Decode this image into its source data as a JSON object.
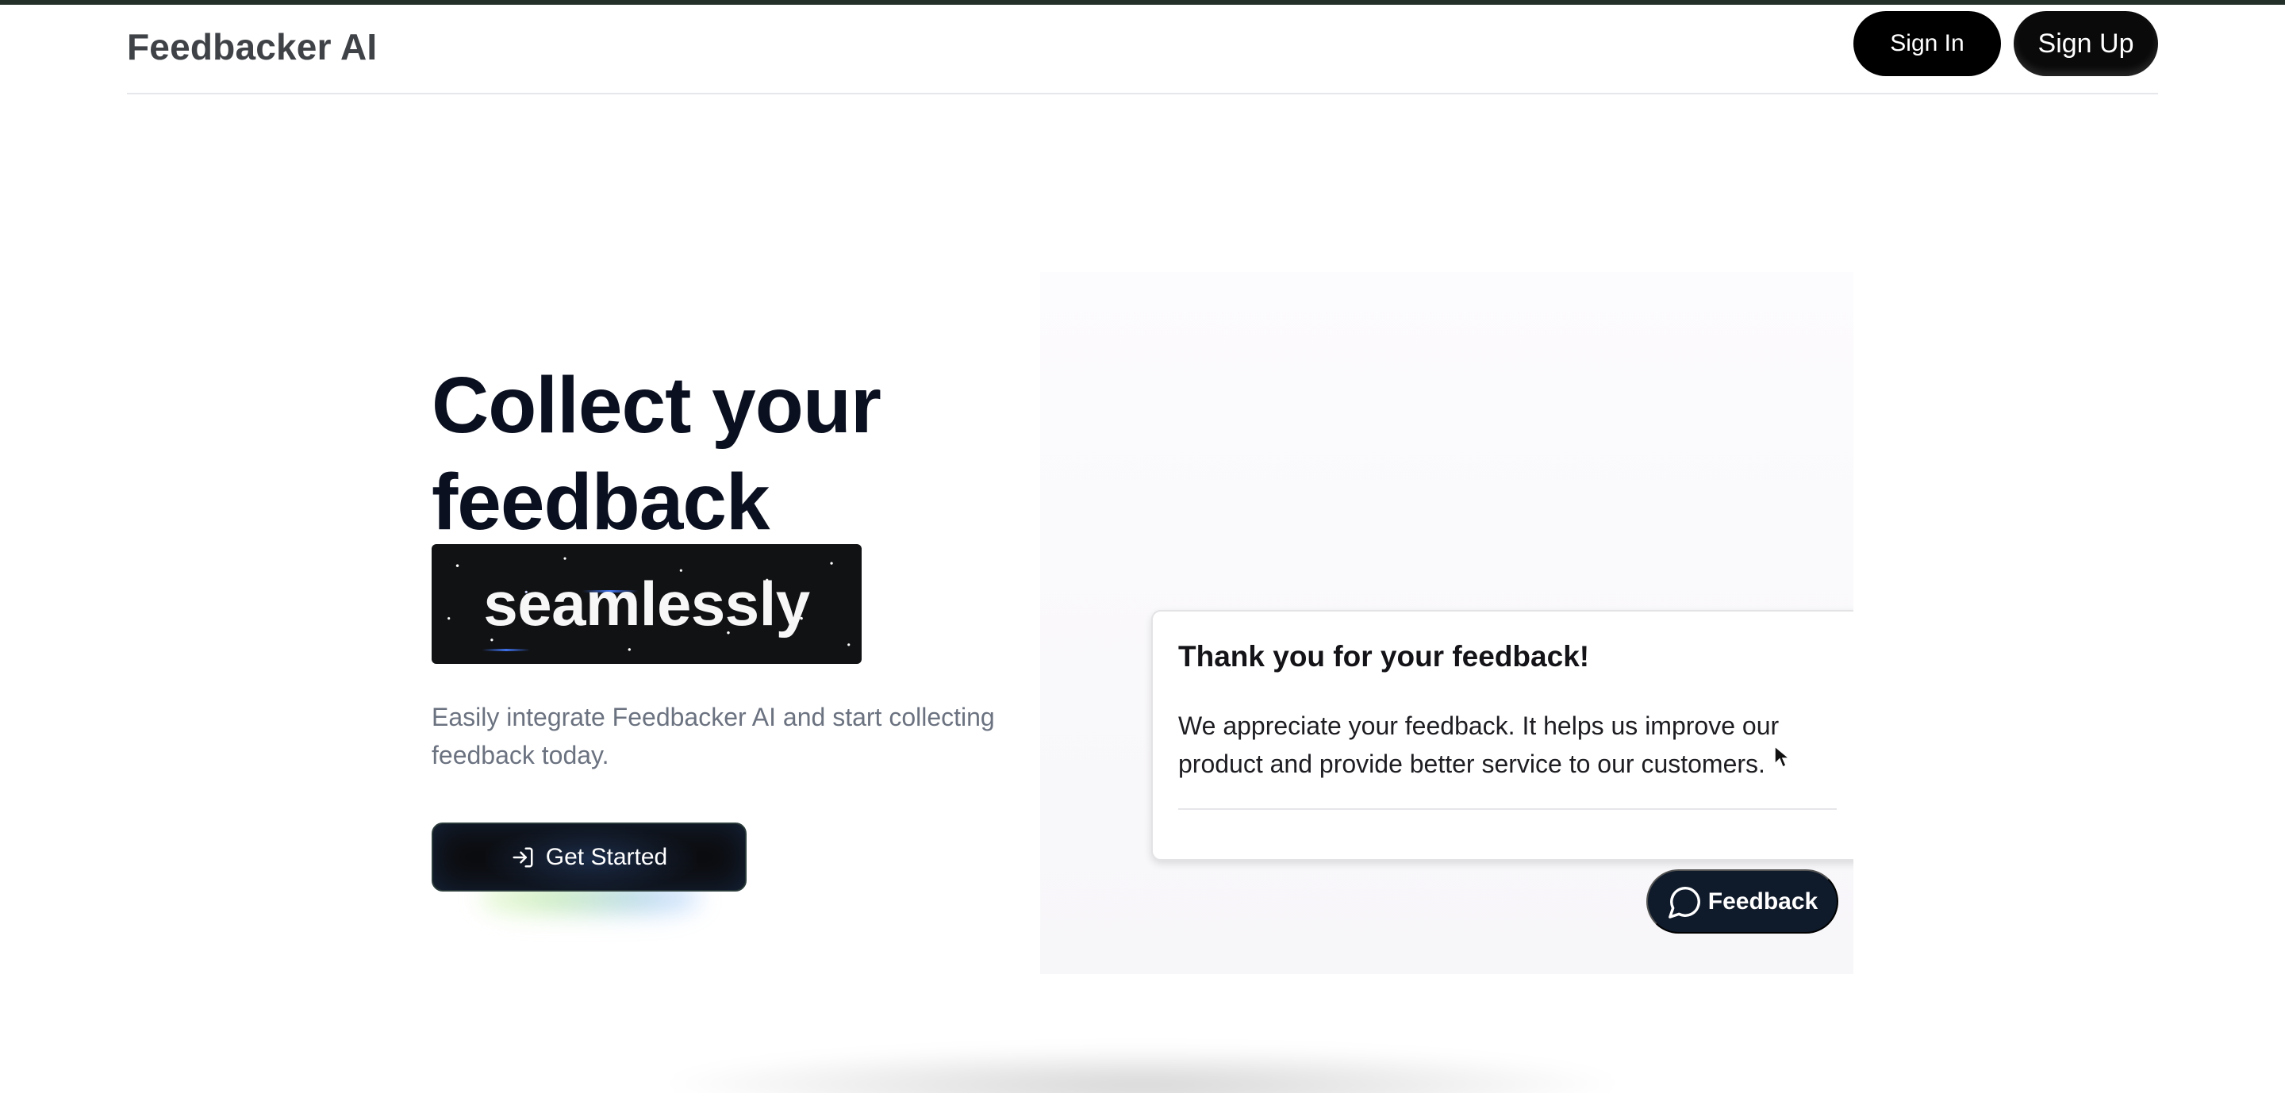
{
  "header": {
    "brand": "Feedbacker AI",
    "sign_in_label": "Sign In",
    "sign_up_label": "Sign Up"
  },
  "hero": {
    "headline_line1": "Collect your",
    "headline_line2": "feedback",
    "highlight_word": "seamlessly",
    "subtitle": "Easily integrate Feedbacker AI and start collecting feedback today.",
    "cta_label": "Get Started",
    "cta_icon": "sign-in-arrow-icon"
  },
  "preview": {
    "toast_title": "Thank you for your feedback!",
    "toast_body": "We appreciate your feedback. It helps us improve our product and provide better service to our customers.",
    "feedback_button_label": "Feedback",
    "feedback_icon": "speech-bubble-icon"
  },
  "colors": {
    "primary_button": "#000000",
    "heading": "#0b1020",
    "subtitle": "#6b7280",
    "feedback_button": "#0f1a2a"
  }
}
